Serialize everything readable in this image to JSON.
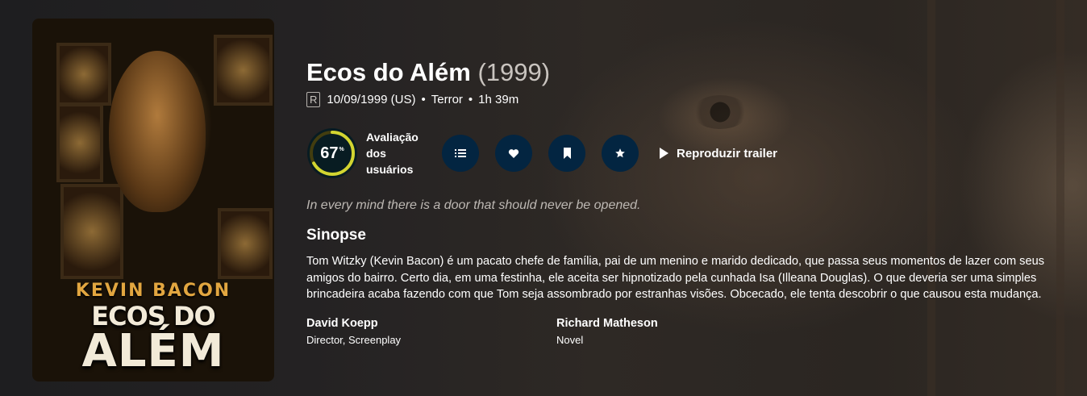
{
  "movie": {
    "title": "Ecos do Além",
    "year": "(1999)",
    "certification": "R",
    "release": "10/09/1999 (US)",
    "genre": "Terror",
    "runtime": "1h 39m",
    "tagline": "In every mind there is a door that should never be opened.",
    "synopsis_heading": "Sinopse",
    "overview": "Tom Witzky (Kevin Bacon) é um pacato chefe de família, pai de um menino e marido dedicado, que passa seus momentos de lazer com seus amigos do bairro. Certo dia, em uma festinha, ele aceita ser hipnotizado pela cunhada Isa (Illeana Douglas). O que deveria ser uma simples brincadeira acaba fazendo com que Tom seja assombrado por estranhas visões. Obcecado, ele tenta descobrir o que causou esta mudança."
  },
  "poster": {
    "actor_text": "KEVIN BACON",
    "title_line1": "ECOS DO",
    "title_line2": "ALÉM"
  },
  "score": {
    "value": "67",
    "percent_sign": "%",
    "fraction": 0.67,
    "label": "Avaliação dos usuários",
    "ring_color": "#d2d531",
    "track_color": "#423d0f",
    "bg_color": "#081c22"
  },
  "actions": {
    "buttons": [
      {
        "icon": "list-icon"
      },
      {
        "icon": "heart-icon"
      },
      {
        "icon": "bookmark-icon"
      },
      {
        "icon": "star-icon"
      }
    ],
    "button_color": "#032541",
    "trailer_label": "Reproduzir trailer"
  },
  "crew": [
    {
      "name": "David Koepp",
      "role": "Director, Screenplay"
    },
    {
      "name": "Richard Matheson",
      "role": "Novel"
    }
  ]
}
